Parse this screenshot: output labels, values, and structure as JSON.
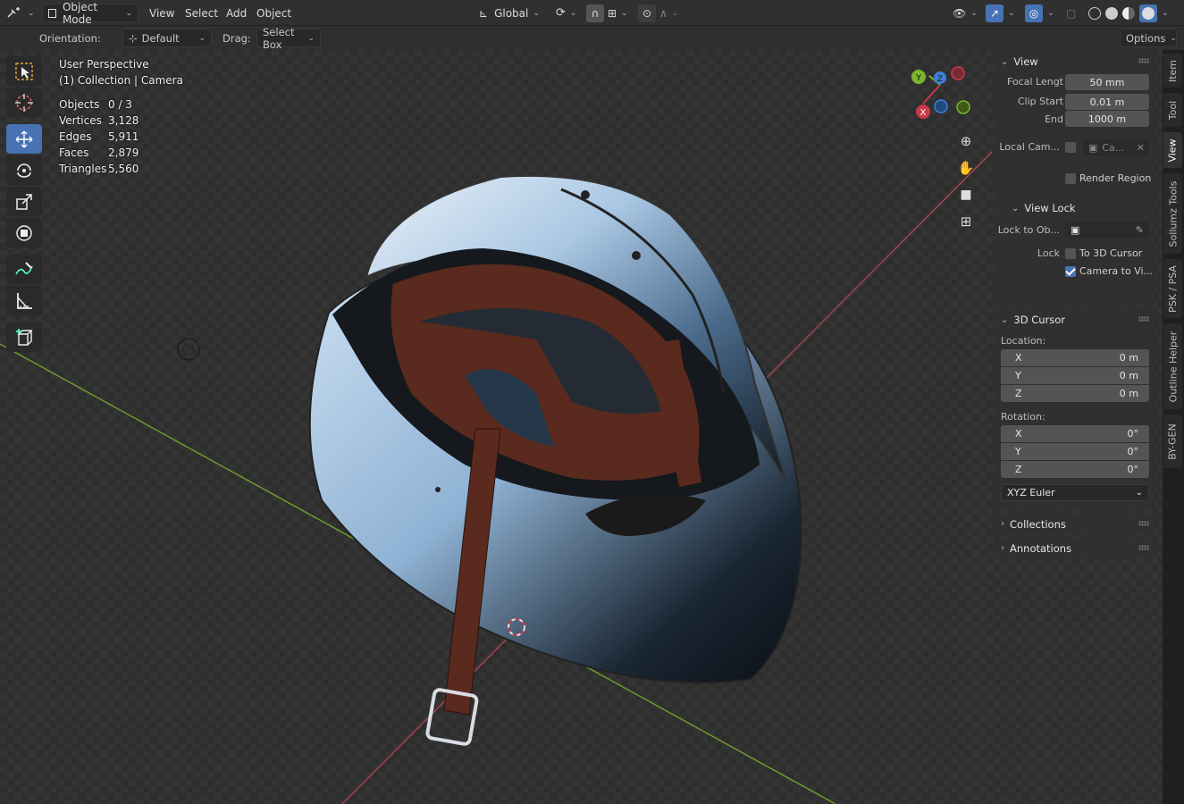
{
  "header": {
    "mode": "Object Mode",
    "menus": [
      "View",
      "Select",
      "Add",
      "Object"
    ],
    "transform_orientation": "Global",
    "options_label": "Options"
  },
  "tool_settings": {
    "orientation_label": "Orientation:",
    "orientation_value": "Default",
    "drag_label": "Drag:",
    "drag_value": "Select Box"
  },
  "viewport": {
    "view_name": "User Perspective",
    "collection": "(1) Collection | Camera",
    "stats": [
      {
        "label": "Objects",
        "value": "0 / 3"
      },
      {
        "label": "Vertices",
        "value": "3,128"
      },
      {
        "label": "Edges",
        "value": "5,911"
      },
      {
        "label": "Faces",
        "value": "2,879"
      },
      {
        "label": "Triangles",
        "value": "5,560"
      }
    ],
    "gizmo": {
      "x": "X",
      "y": "Y",
      "z": "Z"
    }
  },
  "npanel": {
    "view": {
      "title": "View",
      "focal_label": "Focal Lengt",
      "focal_value": "50 mm",
      "clip_start_label": "Clip Start",
      "clip_start_value": "0.01 m",
      "end_label": "End",
      "end_value": "1000 m",
      "local_cam_label": "Local Cam...",
      "local_cam_value": "Ca...",
      "render_region_label": "Render Region"
    },
    "view_lock": {
      "title": "View Lock",
      "lock_to_obj_label": "Lock to Ob...",
      "lock_label": "Lock",
      "to_cursor_label": "To 3D Cursor",
      "camera_to_view_label": "Camera to Vi..."
    },
    "cursor": {
      "title": "3D Cursor",
      "location_label": "Location:",
      "loc": [
        {
          "axis": "X",
          "value": "0 m"
        },
        {
          "axis": "Y",
          "value": "0 m"
        },
        {
          "axis": "Z",
          "value": "0 m"
        }
      ],
      "rotation_label": "Rotation:",
      "rot": [
        {
          "axis": "X",
          "value": "0°"
        },
        {
          "axis": "Y",
          "value": "0°"
        },
        {
          "axis": "Z",
          "value": "0°"
        }
      ],
      "rotation_mode": "XYZ Euler"
    },
    "collections_title": "Collections",
    "annotations_title": "Annotations"
  },
  "side_tabs": [
    "Item",
    "Tool",
    "View",
    "Sollumz Tools",
    "PSK / PSA",
    "Outline Helper",
    "BY-GEN"
  ],
  "colors": {
    "accent": "#4772b3",
    "x_axis": "#c9394a",
    "y_axis": "#7bb52b",
    "z_axis": "#3d7fd6"
  }
}
